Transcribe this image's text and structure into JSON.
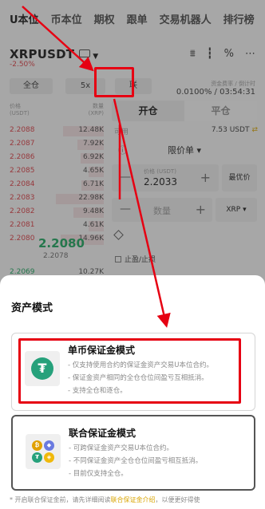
{
  "nav_tabs": [
    "U本位",
    "币本位",
    "期权",
    "跟单",
    "交易机器人",
    "排行榜"
  ],
  "pair": {
    "symbol": "XRPUSDT",
    "change": "-2.50%"
  },
  "controls": {
    "margin_mode": "全仓",
    "leverage": "5x",
    "asset_mode": "联"
  },
  "funding": {
    "label": "资金费率 / 倒计时",
    "value": "0.0100% / 03:54:31"
  },
  "orderbook": {
    "price_header": "价格\n(USDT)",
    "qty_header": "数量\n(XRP)",
    "asks": [
      {
        "price": "2.2088",
        "qty": "12.48K",
        "depth": 0.85
      },
      {
        "price": "2.2087",
        "qty": "7.92K",
        "depth": 0.55
      },
      {
        "price": "2.2086",
        "qty": "6.92K",
        "depth": 0.48
      },
      {
        "price": "2.2085",
        "qty": "4.65K",
        "depth": 0.32
      },
      {
        "price": "2.2084",
        "qty": "6.71K",
        "depth": 0.46
      },
      {
        "price": "2.2083",
        "qty": "22.98K",
        "depth": 1.0
      },
      {
        "price": "2.2082",
        "qty": "9.48K",
        "depth": 0.64
      },
      {
        "price": "2.2081",
        "qty": "4.61K",
        "depth": 0.32
      },
      {
        "price": "2.2080",
        "qty": "14.96K",
        "depth": 0.9
      }
    ],
    "last_price": "2.2080",
    "mark_price": "2.2078",
    "bid": {
      "price": "2.2069",
      "qty": "10.27K"
    }
  },
  "order_panel": {
    "open_tab": "开仓",
    "close_tab": "平仓",
    "available_label": "可用",
    "available_value": "7.53 USDT",
    "order_type": "限价单",
    "price_label": "价格 (USDT)",
    "price_value": "2.2033",
    "best_price": "最优价",
    "qty_placeholder": "数量",
    "qty_unit": "XRP",
    "tpsl_label": "止盈/止损"
  },
  "sheet": {
    "title": "资产模式",
    "single": {
      "title": "单币保证金模式",
      "lines": [
        "- 仅支持使用合约的保证金资产交易U本位合约。",
        "- 保证金资产相同的全仓仓位间盈亏互相抵消。",
        "- 支持全仓和逐仓。"
      ]
    },
    "multi": {
      "title": "联合保证金模式",
      "lines": [
        "- 可跨保证金资产交易U本位合约。",
        "- 不同保证金资产全仓仓位间盈亏相互抵消。",
        "- 目前仅支持全仓。"
      ]
    },
    "footnote_before": "* 开启联合保证金前，请先详细阅读",
    "footnote_link": "联合保证金介绍",
    "footnote_after": "，以便更好得使"
  },
  "colors": {
    "annotation": "#e60012",
    "sell": "#d9383f",
    "buy": "#16a35a",
    "tether": "#26a17b"
  }
}
